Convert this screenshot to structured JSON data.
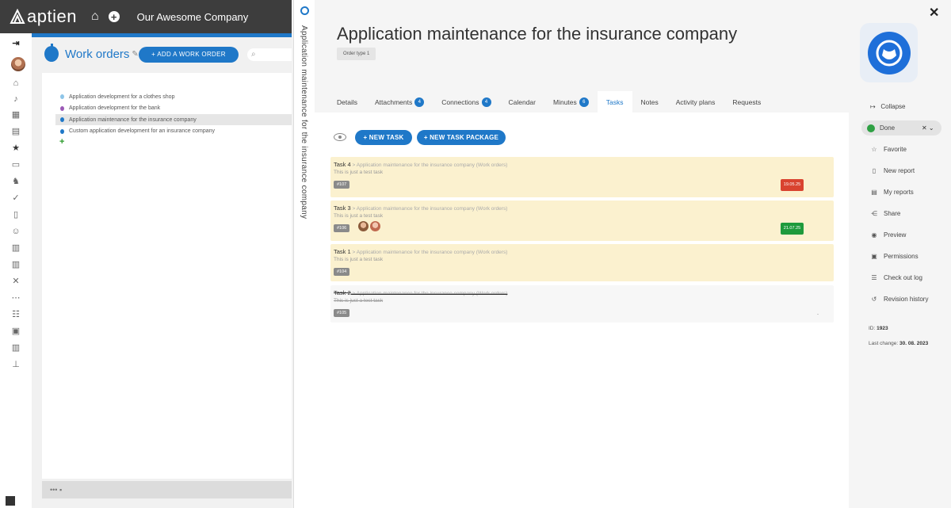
{
  "topbar": {
    "brand": "aptien",
    "company": "Our Awesome Company"
  },
  "work_orders": {
    "title": "Work orders",
    "add_button": "+ ADD A WORK ORDER",
    "items": [
      {
        "label": "Application development for a clothes shop",
        "color": "#8ec5e8"
      },
      {
        "label": "Application development for the bank",
        "color": "#9b59b6"
      },
      {
        "label": "Application maintenance for the insurance company",
        "color": "#1f78c8"
      },
      {
        "label": "Custom application development for an insurance company",
        "color": "#1f78c8"
      }
    ],
    "footer": "••• ▪"
  },
  "vertical_title": "Application maintenance for the insurance company",
  "detail": {
    "title": "Application maintenance for the insurance company",
    "type_badge": "Order type 1",
    "tabs": [
      {
        "label": "Details",
        "badge": ""
      },
      {
        "label": "Attachments",
        "badge": "4"
      },
      {
        "label": "Connections",
        "badge": "4"
      },
      {
        "label": "Calendar",
        "badge": ""
      },
      {
        "label": "Minutes",
        "badge": "6"
      },
      {
        "label": "Tasks",
        "badge": ""
      },
      {
        "label": "Notes",
        "badge": ""
      },
      {
        "label": "Activity plans",
        "badge": ""
      },
      {
        "label": "Requests",
        "badge": ""
      }
    ],
    "new_task": "+ NEW TASK",
    "new_task_package": "+ NEW TASK PACKAGE",
    "tasks": [
      {
        "name": "Task 4",
        "context": " > Application maintenance for the insurance company (Work orders)",
        "desc": "This is just a test task",
        "id": "#107",
        "date": "19.05.25",
        "date_color": "#d9432f"
      },
      {
        "name": "Task 3",
        "context": " > Application maintenance for the insurance company (Work orders)",
        "desc": "This is just a test task",
        "id": "#106",
        "date": "21.07.25",
        "date_color": "#1e9a3c"
      },
      {
        "name": "Task 1",
        "context": " > Application maintenance for the insurance company (Work orders)",
        "desc": "This is just a test task",
        "id": "#104"
      },
      {
        "name": "Task 2",
        "context": " > Application maintenance for the insurance company (Work orders)",
        "desc": "This is just a test task",
        "id": "#105",
        "dash": "-"
      }
    ]
  },
  "sidebar": {
    "collapse": "Collapse",
    "status": "Done",
    "status_controls": "✕ ⌄",
    "items": [
      {
        "label": "Favorite",
        "icon": "star-outline-icon"
      },
      {
        "label": "New report",
        "icon": "document-icon"
      },
      {
        "label": "My reports",
        "icon": "documents-icon"
      },
      {
        "label": "Share",
        "icon": "share-icon"
      },
      {
        "label": "Preview",
        "icon": "eye-icon"
      },
      {
        "label": "Permissions",
        "icon": "permissions-icon"
      },
      {
        "label": "Check out log",
        "icon": "checkout-log-icon"
      },
      {
        "label": "Revision history",
        "icon": "history-icon"
      }
    ],
    "id_label": "ID:",
    "id_value": "1923",
    "last_change_label": "Last change:",
    "last_change_value": "30. 08. 2023"
  }
}
